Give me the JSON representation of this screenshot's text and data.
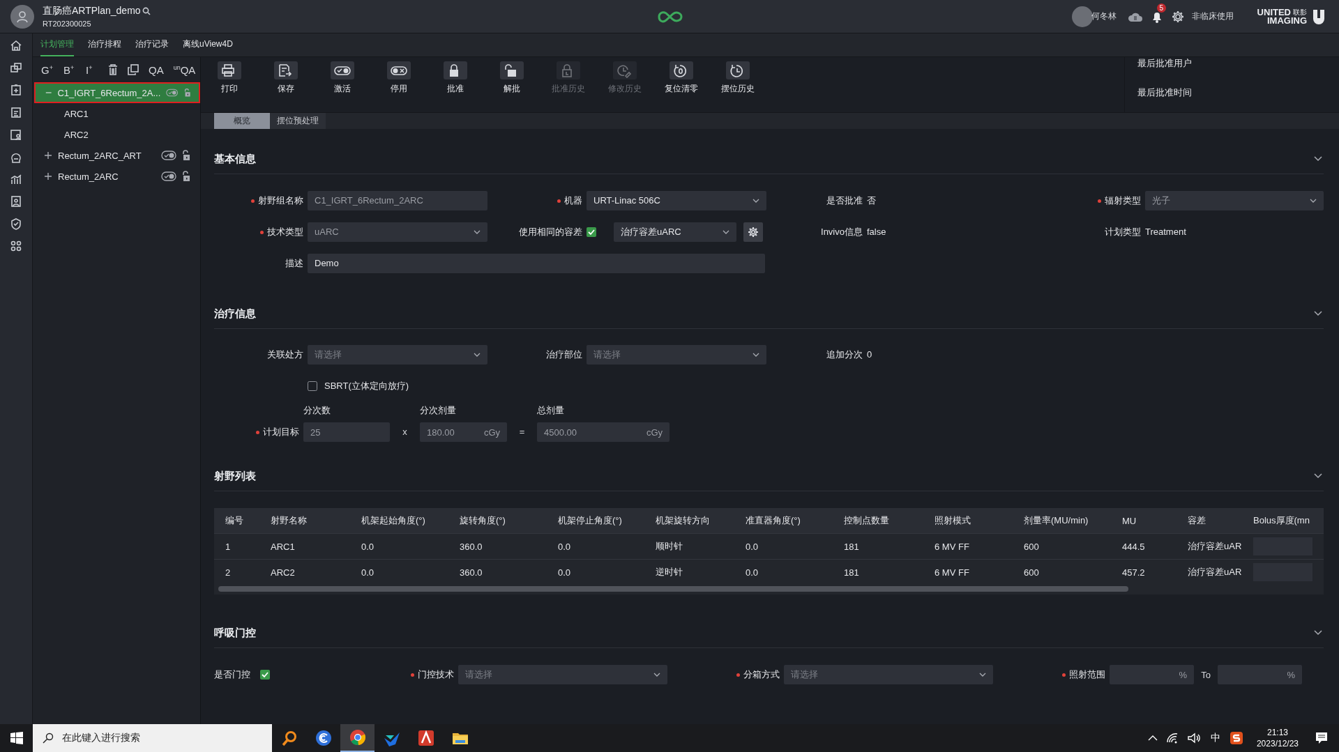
{
  "header": {
    "patient_name": "直肠癌ARTPlan_demo",
    "patient_id": "RT202300025",
    "user_name": "何冬林",
    "notification_count": "5",
    "mode_label": "非临床使用",
    "logo": {
      "word": "UNITED",
      "cn": "联影",
      "word2": "IMAGING"
    }
  },
  "tabs": [
    {
      "label": "计划管理",
      "selected": true
    },
    {
      "label": "治疗排程",
      "selected": false
    },
    {
      "label": "治疗记录",
      "selected": false
    },
    {
      "label": "离线uView4D",
      "selected": false
    }
  ],
  "tree_tools": [
    {
      "kind": "text",
      "label": "G$^{+}$"
    },
    {
      "kind": "text",
      "label": "B$^{+}$"
    },
    {
      "kind": "text",
      "label": "I$^{+}$"
    },
    {
      "kind": "delete"
    },
    {
      "kind": "duplicate"
    },
    {
      "kind": "text",
      "label": "QA"
    },
    {
      "kind": "text",
      "label": "$^{un}$QA"
    }
  ],
  "plan_tree": [
    {
      "label": "C1_IGRT_6Rectum_2A...",
      "expanded": true,
      "selected": true,
      "children": [
        {
          "label": "ARC1"
        },
        {
          "label": "ARC2"
        }
      ]
    },
    {
      "label": "Rectum_2ARC_ART",
      "expanded": false,
      "selected": false
    },
    {
      "label": "Rectum_2ARC",
      "expanded": false,
      "selected": false
    }
  ],
  "toolbar": [
    {
      "kind": "print",
      "label": "打印",
      "disabled": false
    },
    {
      "kind": "save",
      "label": "保存",
      "disabled": false
    },
    {
      "kind": "activate",
      "label": "激活",
      "disabled": false
    },
    {
      "kind": "deactivate",
      "label": "停用",
      "disabled": false
    },
    {
      "kind": "lock",
      "label": "批准",
      "disabled": false
    },
    {
      "kind": "unlock",
      "label": "解批",
      "disabled": false
    },
    {
      "kind": "lock-history",
      "label": "批准历史",
      "disabled": true
    },
    {
      "kind": "edit-history",
      "label": "修改历史",
      "disabled": true
    },
    {
      "kind": "reset",
      "label": "复位清零",
      "disabled": false
    },
    {
      "kind": "history",
      "label": "摆位历史",
      "disabled": false
    }
  ],
  "approval": {
    "user_label": "最后批准用户",
    "time_label": "最后批准时间"
  },
  "sub_tabs": [
    {
      "label": "概览",
      "selected": true
    },
    {
      "label": "摆位预处理",
      "selected": false
    }
  ],
  "basic_info": {
    "title": "基本信息",
    "expanded": true,
    "rows": [
      [
        {
          "kind": "input",
          "label": "射野组名称",
          "required": true,
          "value": "C1_IGRT_6Rectum_2ARC",
          "disabled": true
        },
        {
          "kind": "select",
          "label": "机器",
          "required": true,
          "value": "URT-Linac 506C",
          "disabled": false
        },
        {
          "kind": "text",
          "label": "是否批准",
          "value": "否"
        },
        {
          "kind": "select",
          "label": "辐射类型",
          "required": true,
          "value": "光子",
          "disabled": true
        }
      ],
      [
        {
          "kind": "select",
          "label": "技术类型",
          "required": true,
          "value": "uARC",
          "disabled": true
        },
        {
          "kind": "checkbox-select",
          "label": "使用相同的容差",
          "required": false,
          "checked": true,
          "value": "治疗容差uARC",
          "disabled": false
        },
        {
          "kind": "text",
          "label": "Invivo信息",
          "value": "false"
        },
        {
          "kind": "text",
          "label": "计划类型",
          "value": "Treatment"
        }
      ],
      [
        {
          "kind": "wide-input",
          "label": "描述",
          "required": false,
          "value": "Demo",
          "disabled": false
        }
      ]
    ]
  },
  "treatment_info": {
    "title": "治疗信息",
    "expanded": true,
    "rows": [
      [
        {
          "kind": "select",
          "label": "关联处方",
          "required": false,
          "placeholder": "请选择"
        },
        {
          "kind": "select",
          "label": "治疗部位",
          "required": false,
          "placeholder": "请选择"
        },
        {
          "kind": "text",
          "label": "追加分次",
          "value": "0"
        }
      ],
      [
        {
          "kind": "checkbox",
          "label": "SBRT(立体定向放疗)",
          "checked": false
        }
      ]
    ],
    "plan_target": {
      "label": "计划目标",
      "required": true,
      "parts": [
        {
          "kind": "input",
          "label": "分次数",
          "value": "25"
        },
        {
          "kind": "operator",
          "label": "x"
        },
        {
          "kind": "input",
          "label": "分次剂量",
          "value": "180.00",
          "unit": "cGy"
        },
        {
          "kind": "operator",
          "label": "="
        },
        {
          "kind": "input",
          "label": "总剂量",
          "value": "4500.00",
          "unit": "cGy"
        }
      ]
    }
  },
  "beam_list": {
    "title": "射野列表",
    "expanded": true,
    "columns": [
      "编号",
      "射野名称",
      "机架起始角度(°)",
      "旋转角度(°)",
      "机架停止角度(°)",
      "机架旋转方向",
      "准直器角度(°)",
      "控制点数量",
      "照射模式",
      "剂量率(MU/min)",
      "MU",
      "容差",
      "Bolus厚度(mn"
    ],
    "rows": [
      [
        "1",
        "ARC1",
        "0.0",
        "360.0",
        "0.0",
        "顺时针",
        "0.0",
        "181",
        "6 MV FF",
        "600",
        "444.5",
        "治疗容差uAR"
      ],
      [
        "2",
        "ARC2",
        "0.0",
        "360.0",
        "0.0",
        "逆时针",
        "0.0",
        "181",
        "6 MV FF",
        "600",
        "457.2",
        "治疗容差uAR"
      ]
    ]
  },
  "gating": {
    "title": "呼吸门控",
    "expanded": true,
    "enabled_label": "是否门控",
    "enabled": true,
    "technique": {
      "label": "门控技术",
      "required": true,
      "placeholder": "请选择"
    },
    "binning": {
      "label": "分箱方式",
      "required": true,
      "placeholder": "请选择"
    },
    "range": {
      "label": "照射范围",
      "required": true,
      "from_unit": "%",
      "separator": "To",
      "to_unit": "%"
    }
  },
  "taskbar": {
    "search_placeholder": "在此键入进行搜索",
    "apps": [
      {
        "kind": "magnifier",
        "selected": false
      },
      {
        "kind": "swirl",
        "selected": false
      },
      {
        "kind": "browser",
        "selected": true
      },
      {
        "kind": "bird",
        "selected": false
      },
      {
        "kind": "letter",
        "selected": false
      },
      {
        "kind": "folder",
        "selected": false
      }
    ],
    "ime": "中",
    "time": "21:13",
    "date": "2023/12/23"
  }
}
